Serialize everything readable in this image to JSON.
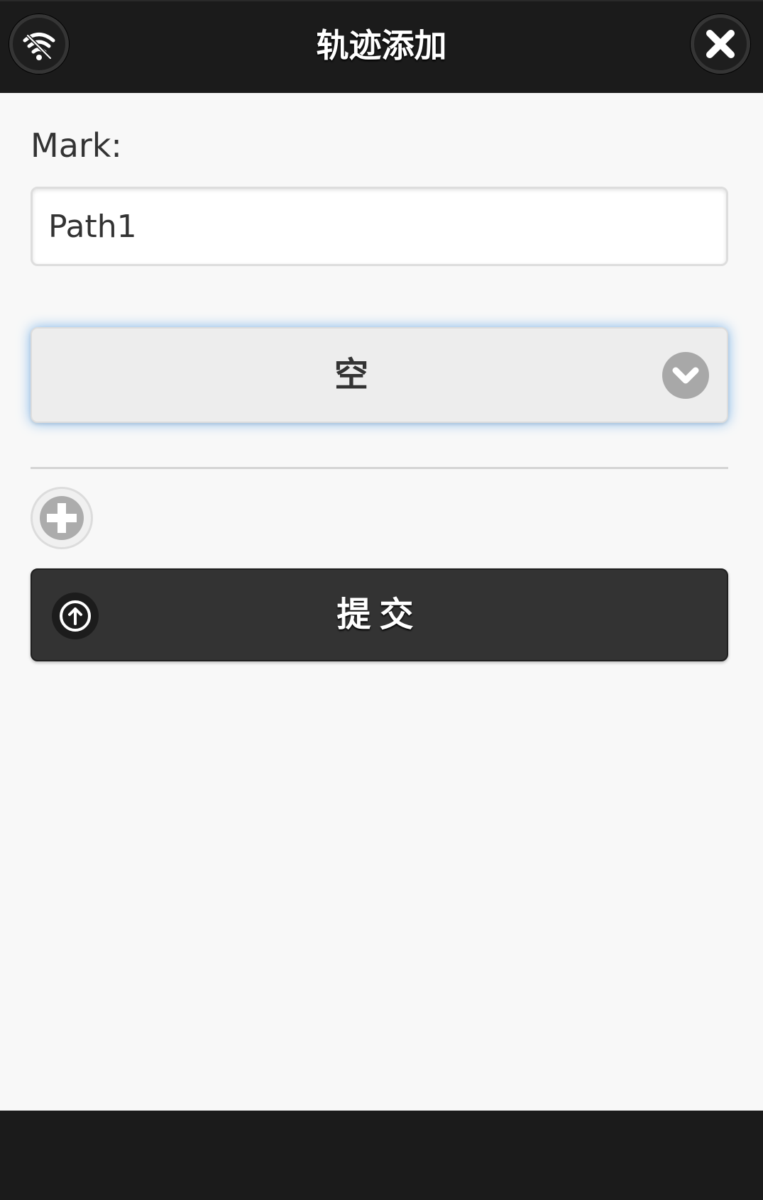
{
  "header": {
    "title": "轨迹添加",
    "left_icon": "wifi-icon",
    "right_icon": "close-icon"
  },
  "form": {
    "mark_label": "Mark:",
    "mark_value": "Path1",
    "select_value": "空",
    "select_icon": "chevron-down-icon",
    "add_icon": "plus-icon",
    "submit_label": "提交",
    "submit_icon": "arrow-up-circle-icon"
  },
  "colors": {
    "header_bg": "#1b1b1b",
    "page_bg": "#f8f8f8",
    "submit_bg": "#333333",
    "focus_glow": "#7fb6ea"
  }
}
